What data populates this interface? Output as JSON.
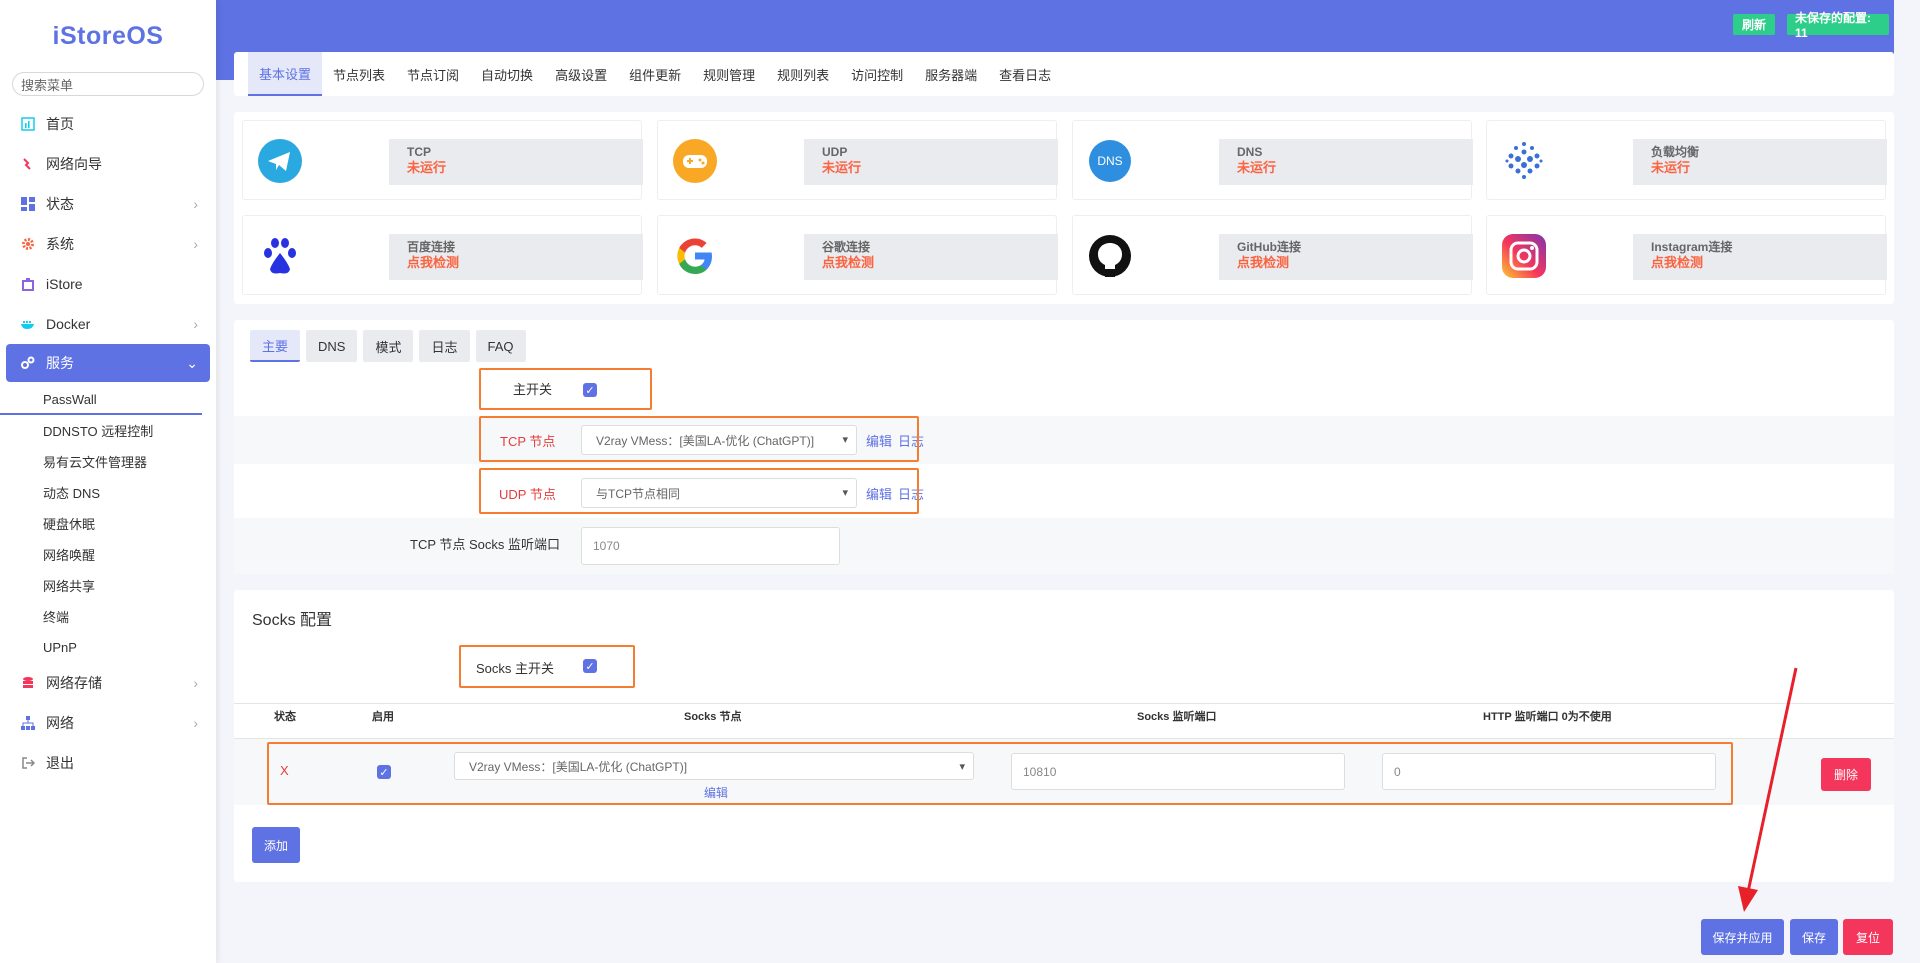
{
  "app": {
    "logo": "iStoreOS",
    "search_placeholder": "搜索菜单"
  },
  "sidebar": {
    "items": [
      {
        "label": "首页",
        "icon": "dashboard-icon",
        "color": "#11cdef",
        "arrow": false
      },
      {
        "label": "网络向导",
        "icon": "wizard-icon",
        "color": "#f5365c",
        "arrow": false
      },
      {
        "label": "状态",
        "icon": "grid-icon",
        "color": "#5e72e4",
        "arrow": true
      },
      {
        "label": "系统",
        "icon": "gear-icon",
        "color": "#fb6340",
        "arrow": true
      },
      {
        "label": "iStore",
        "icon": "store-icon",
        "color": "#8965e0",
        "arrow": false
      },
      {
        "label": "Docker",
        "icon": "docker-icon",
        "color": "#11cdef",
        "arrow": true
      }
    ],
    "active": {
      "label": "服务",
      "icon": "services-icon"
    },
    "sub_items": [
      "PassWall",
      "DDNSTO 远程控制",
      "易有云文件管理器",
      "动态 DNS",
      "硬盘休眠",
      "网络唤醒",
      "网络共享",
      "终端",
      "UPnP"
    ],
    "bottom_items": [
      {
        "label": "网络存储",
        "icon": "storage-icon",
        "color": "#f5365c",
        "arrow": true
      },
      {
        "label": "网络",
        "icon": "network-icon",
        "color": "#5e72e4",
        "arrow": true
      },
      {
        "label": "退出",
        "icon": "logout-icon",
        "color": "#888",
        "arrow": false
      }
    ]
  },
  "header": {
    "refresh_label": "刷新",
    "unsaved_label": "未保存的配置: 11"
  },
  "tabs": [
    "基本设置",
    "节点列表",
    "节点订阅",
    "自动切换",
    "高级设置",
    "组件更新",
    "规则管理",
    "规则列表",
    "访问控制",
    "服务器端",
    "查看日志"
  ],
  "status_cards": [
    {
      "name": "TCP",
      "value": "未运行",
      "icon": "telegram-icon"
    },
    {
      "name": "UDP",
      "value": "未运行",
      "icon": "gamepad-icon"
    },
    {
      "name": "DNS",
      "value": "未运行",
      "icon": "dns-icon"
    },
    {
      "name": "负载均衡",
      "value": "未运行",
      "icon": "load-balance-icon"
    },
    {
      "name": "百度连接",
      "value": "点我检测",
      "icon": "baidu-icon"
    },
    {
      "name": "谷歌连接",
      "value": "点我检测",
      "icon": "google-icon"
    },
    {
      "name": "GitHub连接",
      "value": "点我检测",
      "icon": "github-icon"
    },
    {
      "name": "Instagram连接",
      "value": "点我检测",
      "icon": "instagram-icon"
    }
  ],
  "sub_tabs": [
    "主要",
    "DNS",
    "模式",
    "日志",
    "FAQ"
  ],
  "main": {
    "master_switch_label": "主开关",
    "tcp_node_label": "TCP 节点",
    "tcp_node_value": "V2ray VMess：[美国LA-优化 (ChatGPT)]",
    "udp_node_label": "UDP 节点",
    "udp_node_value": "与TCP节点相同",
    "edit_label": "编辑",
    "log_label": "日志",
    "socks_port_label": "TCP 节点 Socks 监听端口",
    "socks_port_value": "1070"
  },
  "socks": {
    "title": "Socks 配置",
    "master_label": "Socks 主开关",
    "headers": [
      "状态",
      "启用",
      "Socks 节点",
      "Socks 监听端口",
      "HTTP 监听端口 0为不使用"
    ],
    "row": {
      "status": "X",
      "node": "V2ray VMess：[美国LA-优化 (ChatGPT)]",
      "edit": "编辑",
      "port": "10810",
      "http_port": "0",
      "delete": "删除"
    },
    "add_label": "添加"
  },
  "footer": {
    "save_apply": "保存并应用",
    "save": "保存",
    "reset": "复位"
  }
}
